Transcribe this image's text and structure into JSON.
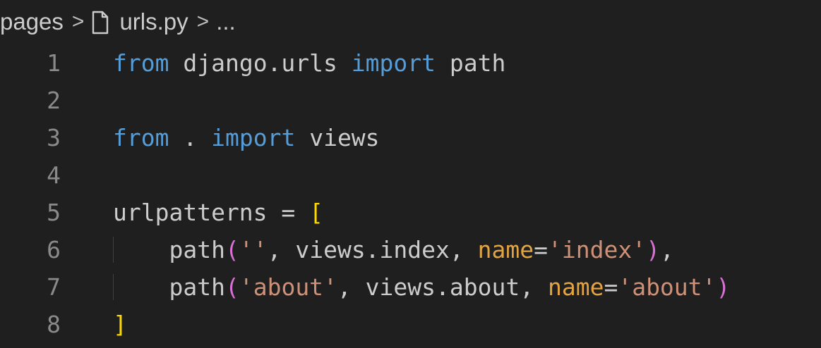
{
  "breadcrumb": {
    "folder": "pages",
    "separator": ">",
    "file_icon": "file-icon",
    "file": "urls.py",
    "ellipsis": "..."
  },
  "colors": {
    "background": "#1f1f1f",
    "keyword": "#569cd6",
    "identifier": "#cccccc",
    "string": "#ce9178",
    "parameter": "#e2a341",
    "bracket_square": "#ffd700",
    "bracket_paren": "#da70d6",
    "line_number": "#8a8a8a"
  },
  "lines": [
    {
      "number": "1"
    },
    {
      "number": "2"
    },
    {
      "number": "3"
    },
    {
      "number": "4"
    },
    {
      "number": "5"
    },
    {
      "number": "6"
    },
    {
      "number": "7"
    },
    {
      "number": "8"
    }
  ],
  "tokens": {
    "from": "from",
    "import": "import",
    "django_urls": "django.urls",
    "path": "path",
    "dot": ".",
    "views": "views",
    "urlpatterns": "urlpatterns",
    "equals": "=",
    "lbracket": "[",
    "rbracket": "]",
    "lparen": "(",
    "rparen": ")",
    "comma": ",",
    "empty_str": "''",
    "views_index": "views.index",
    "name_kw": "name",
    "index_str": "'index'",
    "about_str": "'about'",
    "views_about": "views.about"
  }
}
